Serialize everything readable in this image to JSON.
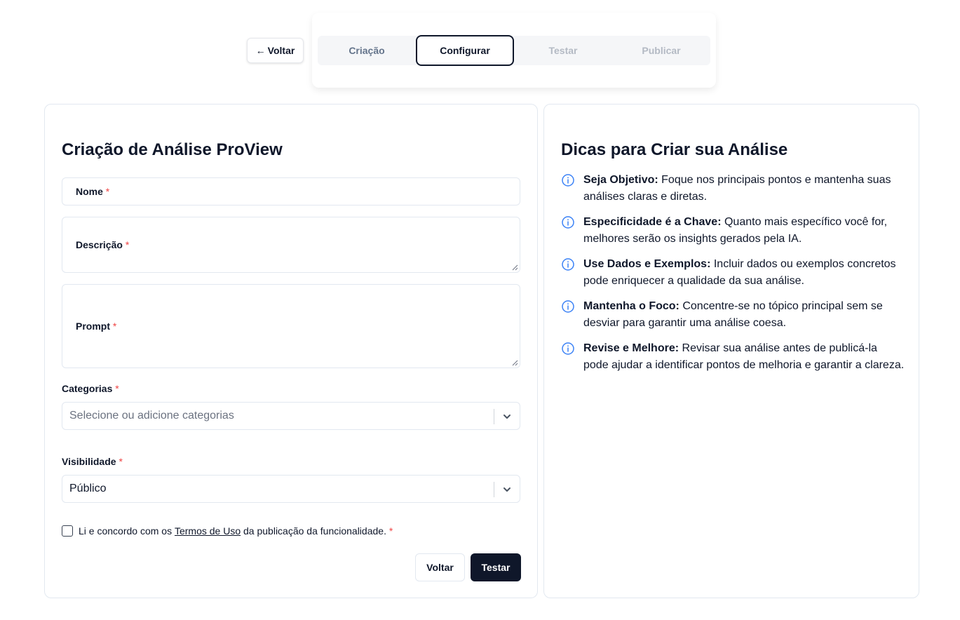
{
  "top": {
    "back_label": "Voltar",
    "steps": [
      {
        "label": "Criação",
        "state": "completed"
      },
      {
        "label": "Configurar",
        "state": "active"
      },
      {
        "label": "Testar",
        "state": "disabled"
      },
      {
        "label": "Publicar",
        "state": "disabled"
      }
    ]
  },
  "form": {
    "title": "Criação de Análise ProView",
    "name_label": "Nome",
    "description_label": "Descrição",
    "prompt_label": "Prompt",
    "required_mark": "*",
    "categories_label": "Categorias",
    "categories_placeholder": "Selecione ou adicione categorias",
    "visibility_label": "Visibilidade",
    "visibility_value": "Público",
    "terms_prefix": "Li e concordo com os",
    "terms_link": "Termos de Uso",
    "terms_suffix": "da publicação da funcionalidade.",
    "back_button": "Voltar",
    "test_button": "Testar"
  },
  "tips": {
    "title": "Dicas para Criar sua Análise",
    "items": [
      {
        "bold": "Seja Objetivo:",
        "text": "Foque nos principais pontos e mantenha suas análises claras e diretas."
      },
      {
        "bold": "Especificidade é a Chave:",
        "text": "Quanto mais específico você for, melhores serão os insights gerados pela IA."
      },
      {
        "bold": "Use Dados e Exemplos:",
        "text": "Incluir dados ou exemplos concretos pode enriquecer a qualidade da sua análise."
      },
      {
        "bold": "Mantenha o Foco:",
        "text": "Concentre-se no tópico principal sem se desviar para garantir uma análise coesa."
      },
      {
        "bold": "Revise e Melhore:",
        "text": "Revisar sua análise antes de publicá-la pode ajudar a identificar pontos de melhoria e garantir a clareza."
      }
    ]
  },
  "colors": {
    "primary": "#0f172a",
    "required": "#ef4444",
    "info_icon": "#3b82f6"
  }
}
